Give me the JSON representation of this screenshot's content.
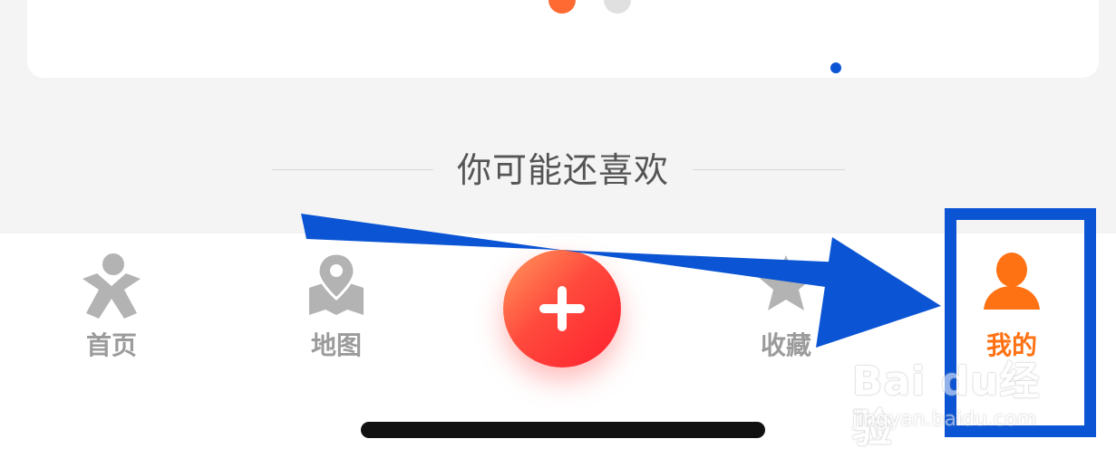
{
  "carousel": {
    "active_index": 0,
    "total": 2
  },
  "recommend": {
    "title": "你可能还喜欢"
  },
  "tabbar": {
    "items": [
      {
        "label": "首页",
        "icon": "home-person-icon"
      },
      {
        "label": "地图",
        "icon": "map-pin-icon"
      },
      {
        "label": "",
        "icon": "plus-icon"
      },
      {
        "label": "收藏",
        "icon": "star-icon"
      },
      {
        "label": "我的",
        "icon": "user-icon"
      }
    ],
    "selected_index": 4
  },
  "watermark": {
    "brand": "Bai du经验",
    "url": "jingyan.baidu.com"
  },
  "colors": {
    "accent": "#ff7214",
    "annotation": "#0b55d4",
    "inactive": "#9b9b9b"
  }
}
